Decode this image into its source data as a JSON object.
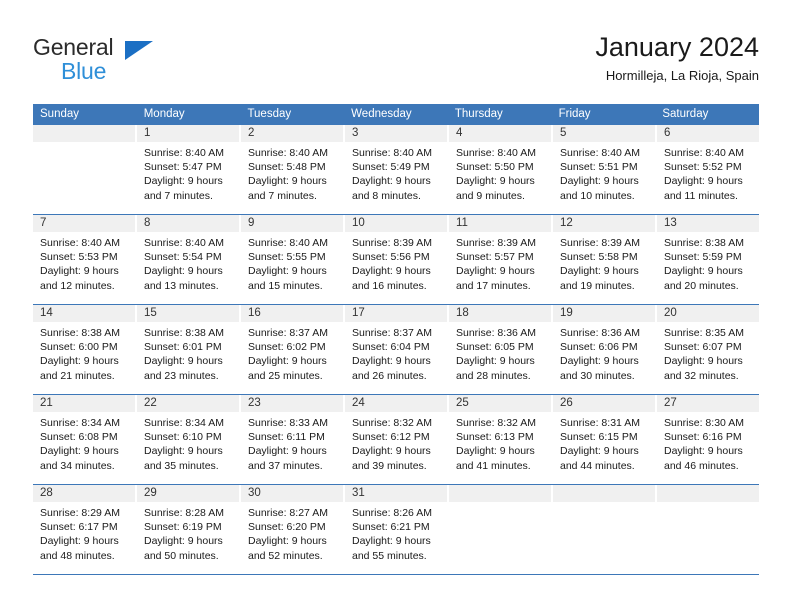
{
  "brand": {
    "name_part1": "General",
    "name_part2": "Blue",
    "triangle_color": "#1b6fc4",
    "blue_text_color": "#2f8fd8"
  },
  "header": {
    "month_title": "January 2024",
    "location": "Hormilleja, La Rioja, Spain"
  },
  "theme": {
    "header_blue": "#3d77b8",
    "daynum_background": "#f0f0f0"
  },
  "weekdays": [
    "Sunday",
    "Monday",
    "Tuesday",
    "Wednesday",
    "Thursday",
    "Friday",
    "Saturday"
  ],
  "weeks": [
    [
      {
        "day": "",
        "sunrise": "",
        "sunset": "",
        "daylight1": "",
        "daylight2": ""
      },
      {
        "day": "1",
        "sunrise": "Sunrise: 8:40 AM",
        "sunset": "Sunset: 5:47 PM",
        "daylight1": "Daylight: 9 hours",
        "daylight2": "and 7 minutes."
      },
      {
        "day": "2",
        "sunrise": "Sunrise: 8:40 AM",
        "sunset": "Sunset: 5:48 PM",
        "daylight1": "Daylight: 9 hours",
        "daylight2": "and 7 minutes."
      },
      {
        "day": "3",
        "sunrise": "Sunrise: 8:40 AM",
        "sunset": "Sunset: 5:49 PM",
        "daylight1": "Daylight: 9 hours",
        "daylight2": "and 8 minutes."
      },
      {
        "day": "4",
        "sunrise": "Sunrise: 8:40 AM",
        "sunset": "Sunset: 5:50 PM",
        "daylight1": "Daylight: 9 hours",
        "daylight2": "and 9 minutes."
      },
      {
        "day": "5",
        "sunrise": "Sunrise: 8:40 AM",
        "sunset": "Sunset: 5:51 PM",
        "daylight1": "Daylight: 9 hours",
        "daylight2": "and 10 minutes."
      },
      {
        "day": "6",
        "sunrise": "Sunrise: 8:40 AM",
        "sunset": "Sunset: 5:52 PM",
        "daylight1": "Daylight: 9 hours",
        "daylight2": "and 11 minutes."
      }
    ],
    [
      {
        "day": "7",
        "sunrise": "Sunrise: 8:40 AM",
        "sunset": "Sunset: 5:53 PM",
        "daylight1": "Daylight: 9 hours",
        "daylight2": "and 12 minutes."
      },
      {
        "day": "8",
        "sunrise": "Sunrise: 8:40 AM",
        "sunset": "Sunset: 5:54 PM",
        "daylight1": "Daylight: 9 hours",
        "daylight2": "and 13 minutes."
      },
      {
        "day": "9",
        "sunrise": "Sunrise: 8:40 AM",
        "sunset": "Sunset: 5:55 PM",
        "daylight1": "Daylight: 9 hours",
        "daylight2": "and 15 minutes."
      },
      {
        "day": "10",
        "sunrise": "Sunrise: 8:39 AM",
        "sunset": "Sunset: 5:56 PM",
        "daylight1": "Daylight: 9 hours",
        "daylight2": "and 16 minutes."
      },
      {
        "day": "11",
        "sunrise": "Sunrise: 8:39 AM",
        "sunset": "Sunset: 5:57 PM",
        "daylight1": "Daylight: 9 hours",
        "daylight2": "and 17 minutes."
      },
      {
        "day": "12",
        "sunrise": "Sunrise: 8:39 AM",
        "sunset": "Sunset: 5:58 PM",
        "daylight1": "Daylight: 9 hours",
        "daylight2": "and 19 minutes."
      },
      {
        "day": "13",
        "sunrise": "Sunrise: 8:38 AM",
        "sunset": "Sunset: 5:59 PM",
        "daylight1": "Daylight: 9 hours",
        "daylight2": "and 20 minutes."
      }
    ],
    [
      {
        "day": "14",
        "sunrise": "Sunrise: 8:38 AM",
        "sunset": "Sunset: 6:00 PM",
        "daylight1": "Daylight: 9 hours",
        "daylight2": "and 21 minutes."
      },
      {
        "day": "15",
        "sunrise": "Sunrise: 8:38 AM",
        "sunset": "Sunset: 6:01 PM",
        "daylight1": "Daylight: 9 hours",
        "daylight2": "and 23 minutes."
      },
      {
        "day": "16",
        "sunrise": "Sunrise: 8:37 AM",
        "sunset": "Sunset: 6:02 PM",
        "daylight1": "Daylight: 9 hours",
        "daylight2": "and 25 minutes."
      },
      {
        "day": "17",
        "sunrise": "Sunrise: 8:37 AM",
        "sunset": "Sunset: 6:04 PM",
        "daylight1": "Daylight: 9 hours",
        "daylight2": "and 26 minutes."
      },
      {
        "day": "18",
        "sunrise": "Sunrise: 8:36 AM",
        "sunset": "Sunset: 6:05 PM",
        "daylight1": "Daylight: 9 hours",
        "daylight2": "and 28 minutes."
      },
      {
        "day": "19",
        "sunrise": "Sunrise: 8:36 AM",
        "sunset": "Sunset: 6:06 PM",
        "daylight1": "Daylight: 9 hours",
        "daylight2": "and 30 minutes."
      },
      {
        "day": "20",
        "sunrise": "Sunrise: 8:35 AM",
        "sunset": "Sunset: 6:07 PM",
        "daylight1": "Daylight: 9 hours",
        "daylight2": "and 32 minutes."
      }
    ],
    [
      {
        "day": "21",
        "sunrise": "Sunrise: 8:34 AM",
        "sunset": "Sunset: 6:08 PM",
        "daylight1": "Daylight: 9 hours",
        "daylight2": "and 34 minutes."
      },
      {
        "day": "22",
        "sunrise": "Sunrise: 8:34 AM",
        "sunset": "Sunset: 6:10 PM",
        "daylight1": "Daylight: 9 hours",
        "daylight2": "and 35 minutes."
      },
      {
        "day": "23",
        "sunrise": "Sunrise: 8:33 AM",
        "sunset": "Sunset: 6:11 PM",
        "daylight1": "Daylight: 9 hours",
        "daylight2": "and 37 minutes."
      },
      {
        "day": "24",
        "sunrise": "Sunrise: 8:32 AM",
        "sunset": "Sunset: 6:12 PM",
        "daylight1": "Daylight: 9 hours",
        "daylight2": "and 39 minutes."
      },
      {
        "day": "25",
        "sunrise": "Sunrise: 8:32 AM",
        "sunset": "Sunset: 6:13 PM",
        "daylight1": "Daylight: 9 hours",
        "daylight2": "and 41 minutes."
      },
      {
        "day": "26",
        "sunrise": "Sunrise: 8:31 AM",
        "sunset": "Sunset: 6:15 PM",
        "daylight1": "Daylight: 9 hours",
        "daylight2": "and 44 minutes."
      },
      {
        "day": "27",
        "sunrise": "Sunrise: 8:30 AM",
        "sunset": "Sunset: 6:16 PM",
        "daylight1": "Daylight: 9 hours",
        "daylight2": "and 46 minutes."
      }
    ],
    [
      {
        "day": "28",
        "sunrise": "Sunrise: 8:29 AM",
        "sunset": "Sunset: 6:17 PM",
        "daylight1": "Daylight: 9 hours",
        "daylight2": "and 48 minutes."
      },
      {
        "day": "29",
        "sunrise": "Sunrise: 8:28 AM",
        "sunset": "Sunset: 6:19 PM",
        "daylight1": "Daylight: 9 hours",
        "daylight2": "and 50 minutes."
      },
      {
        "day": "30",
        "sunrise": "Sunrise: 8:27 AM",
        "sunset": "Sunset: 6:20 PM",
        "daylight1": "Daylight: 9 hours",
        "daylight2": "and 52 minutes."
      },
      {
        "day": "31",
        "sunrise": "Sunrise: 8:26 AM",
        "sunset": "Sunset: 6:21 PM",
        "daylight1": "Daylight: 9 hours",
        "daylight2": "and 55 minutes."
      },
      {
        "day": "",
        "sunrise": "",
        "sunset": "",
        "daylight1": "",
        "daylight2": ""
      },
      {
        "day": "",
        "sunrise": "",
        "sunset": "",
        "daylight1": "",
        "daylight2": ""
      },
      {
        "day": "",
        "sunrise": "",
        "sunset": "",
        "daylight1": "",
        "daylight2": ""
      }
    ]
  ]
}
